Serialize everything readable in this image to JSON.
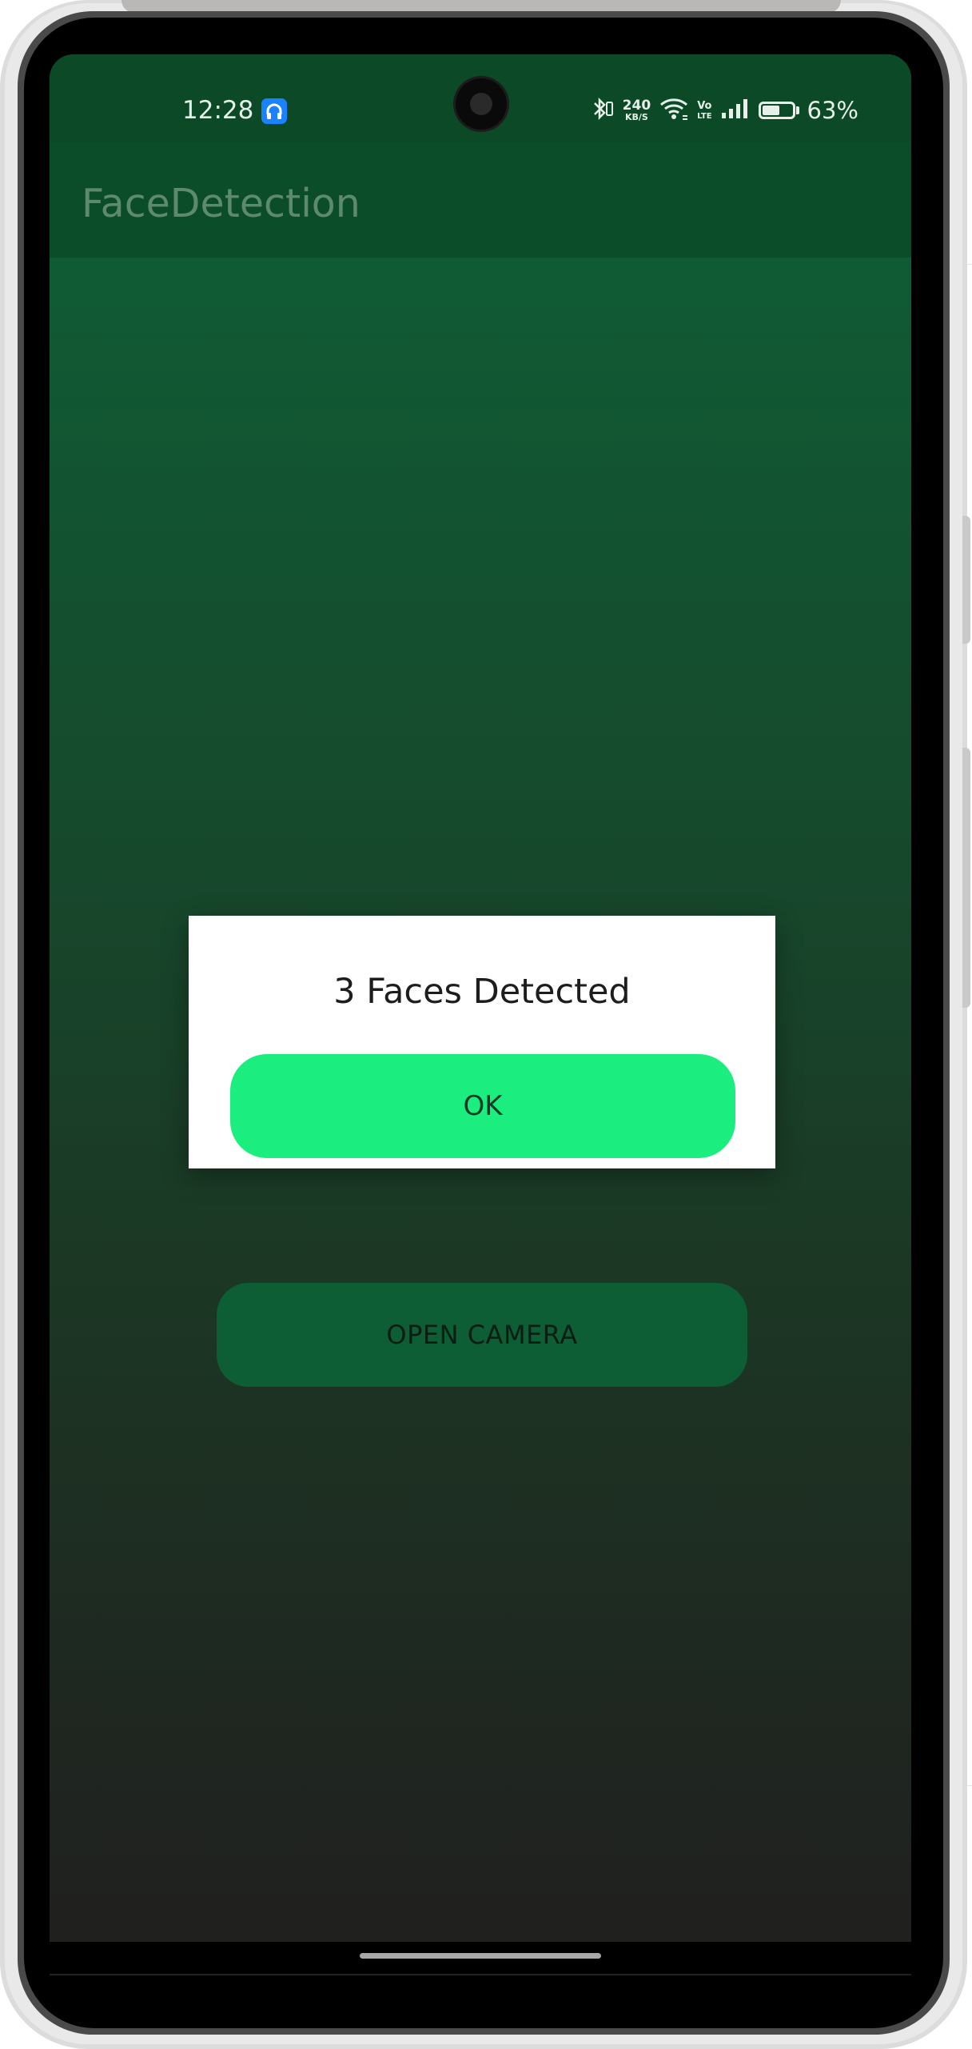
{
  "status_bar": {
    "time": "12:28",
    "net_speed_value": "240",
    "net_speed_unit": "KB/S",
    "volte_top": "Vo",
    "volte_bottom": "LTE",
    "battery_level": 0.63,
    "battery_percent": "63%"
  },
  "app_bar": {
    "title": "FaceDetection"
  },
  "main": {
    "open_camera_label": "OPEN CAMERA"
  },
  "dialog": {
    "message": "3 Faces Detected",
    "ok_label": "OK"
  },
  "colors": {
    "status_bar_bg": "#0c4a27",
    "app_bar_bg": "#0c4d29",
    "dialog_button": "#1ced7f",
    "open_camera_button": "#0d5d35"
  }
}
